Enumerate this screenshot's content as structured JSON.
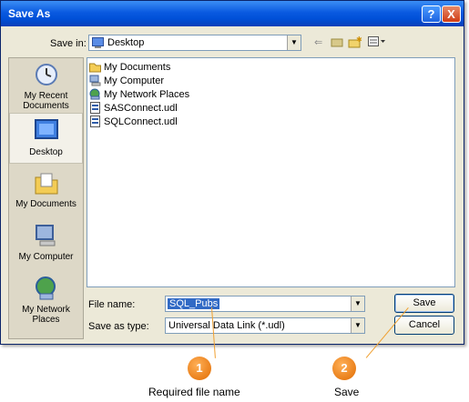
{
  "window": {
    "title": "Save As",
    "help_label": "?",
    "close_label": "X"
  },
  "save_in": {
    "label": "Save in:",
    "value": "Desktop"
  },
  "places": [
    {
      "label": "My Recent Documents",
      "icon": "recent-documents-icon"
    },
    {
      "label": "Desktop",
      "icon": "desktop-icon"
    },
    {
      "label": "My Documents",
      "icon": "my-documents-icon"
    },
    {
      "label": "My Computer",
      "icon": "my-computer-icon"
    },
    {
      "label": "My Network Places",
      "icon": "network-places-icon"
    }
  ],
  "files": [
    {
      "name": "My Documents",
      "icon": "folder-icon"
    },
    {
      "name": "My Computer",
      "icon": "computer-icon"
    },
    {
      "name": "My Network Places",
      "icon": "network-icon"
    },
    {
      "name": "SASConnect.udl",
      "icon": "udl-file-icon"
    },
    {
      "name": "SQLConnect.udl",
      "icon": "udl-file-icon"
    }
  ],
  "form": {
    "file_name_label": "File name:",
    "file_name_value": "SQL_Pubs",
    "save_type_label": "Save as type:",
    "save_type_value": "Universal Data Link (*.udl)"
  },
  "buttons": {
    "save": "Save",
    "cancel": "Cancel"
  },
  "callouts": [
    {
      "number": "1",
      "caption": "Required file name"
    },
    {
      "number": "2",
      "caption": "Save"
    }
  ],
  "colors": {
    "titlebar": "#0a5ae0",
    "dialog_bg": "#ece9d8",
    "selection": "#316ac5",
    "callout": "#f08a1c"
  }
}
